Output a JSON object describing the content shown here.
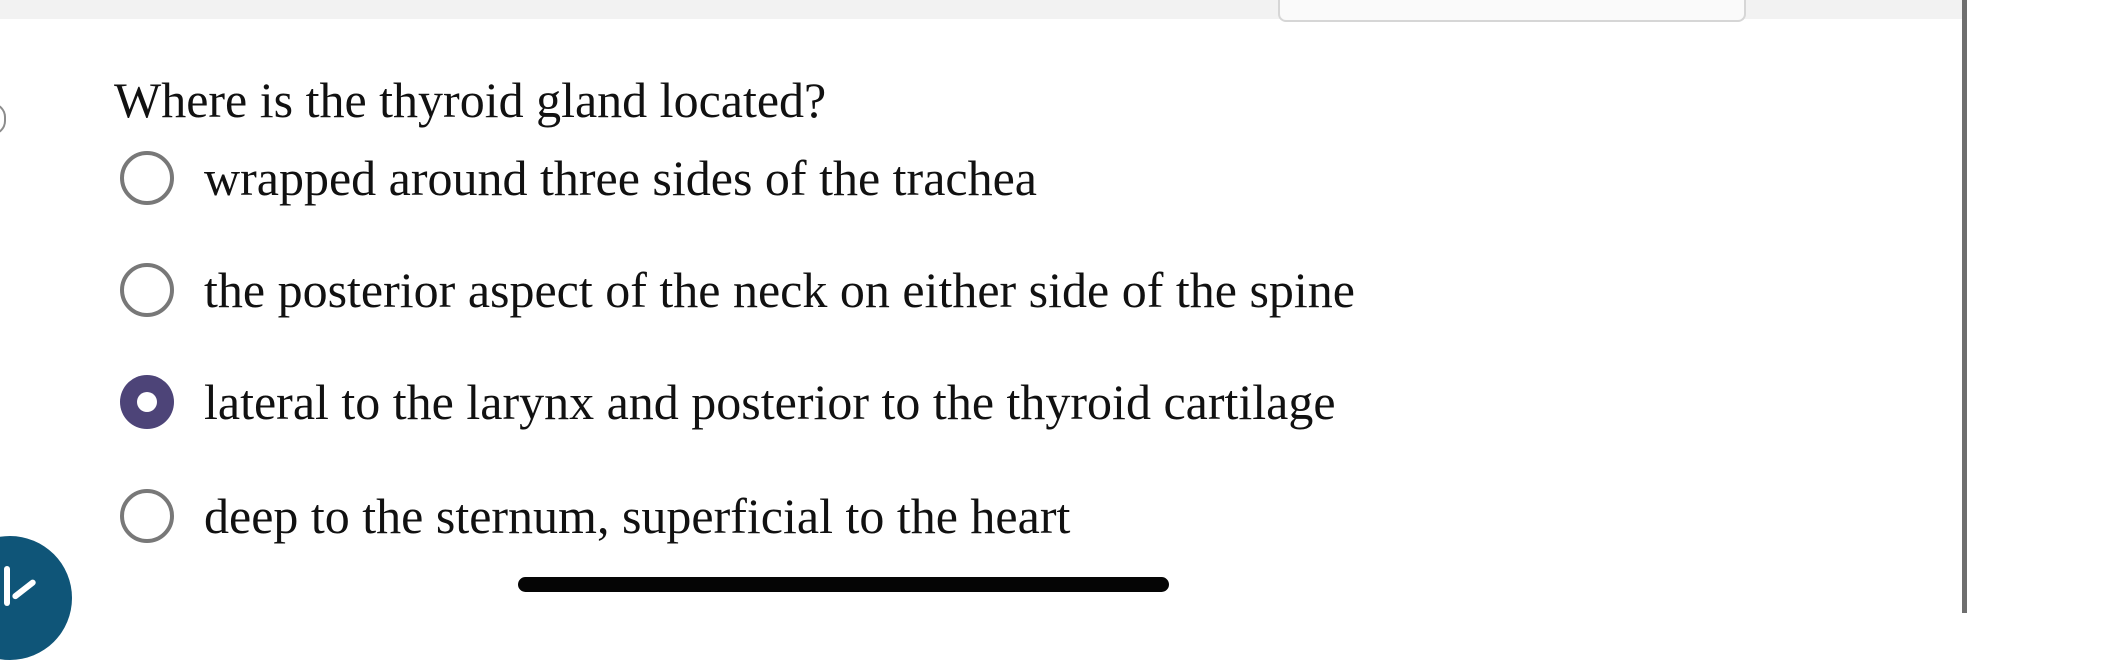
{
  "question": {
    "prompt": "Where is the thyroid gland located?"
  },
  "options": [
    {
      "label": "wrapped around three sides of the trachea",
      "selected": false
    },
    {
      "label": "the posterior aspect of the neck on either side of the spine",
      "selected": false
    },
    {
      "label": "lateral to the larynx and posterior to the thyroid cartilage",
      "selected": true
    },
    {
      "label": "deep to the sternum, superficial to the heart",
      "selected": false
    }
  ],
  "colors": {
    "selected_radio": "#4d4478",
    "floating_button": "#0f5578",
    "home_indicator": "#050505"
  },
  "icons": {
    "floating_button": "collapse-arrow-icon"
  }
}
